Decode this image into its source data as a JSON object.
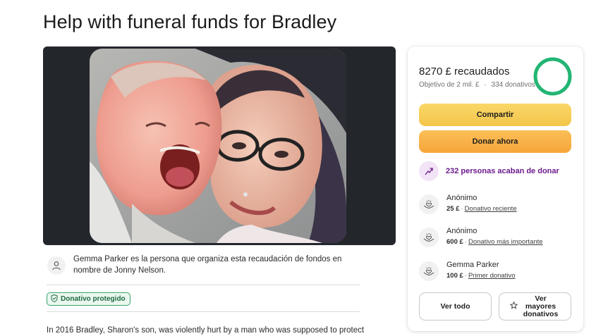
{
  "page": {
    "title": "Help with funeral funds for Bradley"
  },
  "organizer": {
    "text": "Gemma Parker es la persona que organiza esta recaudación de fondos en nombre de Jonny Nelson."
  },
  "badge": {
    "label": "Donativo protegido"
  },
  "story": {
    "first_line": "In 2016 Bradley, Sharon's son, was violently hurt by a man who was supposed to protect"
  },
  "donation_card": {
    "raised": "8270 £ recaudados",
    "goal_line": "Objetivo de 2 mil. £",
    "separator": "·",
    "donors_count": "334 donativos",
    "progress_fraction": 1.0,
    "share_label": "Compartir",
    "donate_label": "Donar ahora",
    "recent_label": "232 personas acaban de donar",
    "donors": [
      {
        "name": "Anónimo",
        "amount": "25 £",
        "tag": "Donativo reciente"
      },
      {
        "name": "Anónimo",
        "amount": "600 £",
        "tag": "Donativo más importante"
      },
      {
        "name": "Gemma Parker",
        "amount": "100 £",
        "tag": "Primer donativo"
      }
    ],
    "see_all_label": "Ver todo",
    "see_top_label": "Ver mayores donativos"
  },
  "icons": {
    "organizer": "person-icon",
    "badge": "shield-check-icon",
    "recent": "trending-up-icon",
    "donor": "heart-hands-icon",
    "star": "star-icon"
  },
  "colors": {
    "share": "#f3c54a",
    "donate": "#f6a53a",
    "progress": "#22b573",
    "recent_text": "#6b1b8c"
  }
}
